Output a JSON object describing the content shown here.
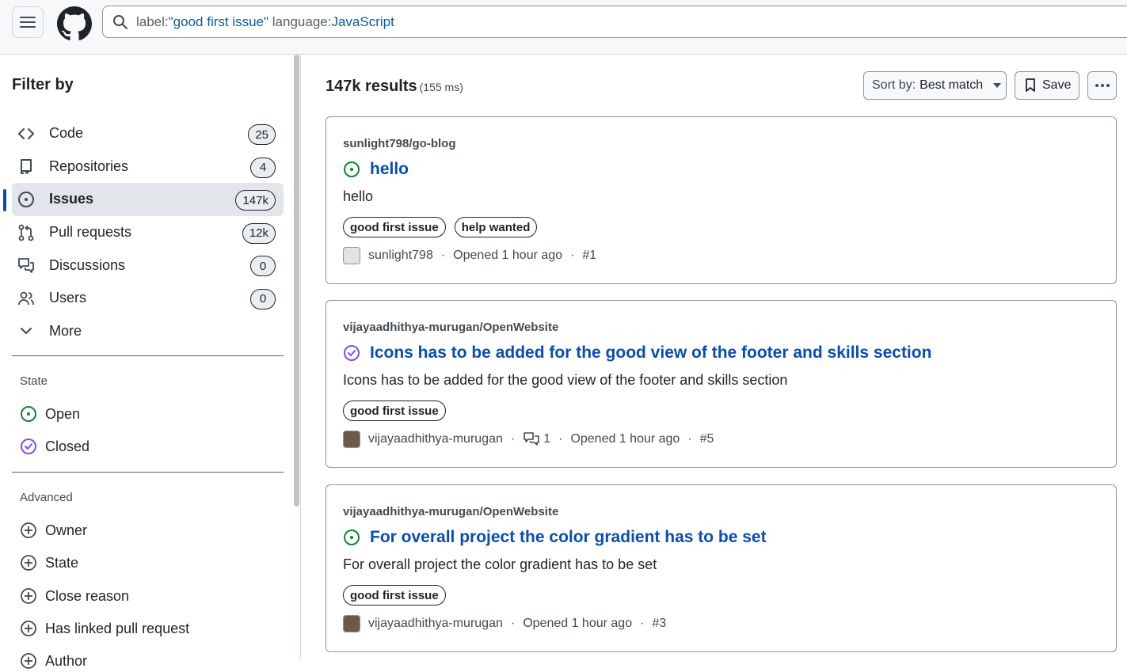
{
  "search": {
    "query_key1": "label:",
    "query_val1": "\"good first issue\"",
    "query_key2": " language:",
    "query_val2": "JavaScript"
  },
  "sidebar": {
    "title": "Filter by",
    "items": [
      {
        "label": "Code",
        "count": "25",
        "icon": "code-icon"
      },
      {
        "label": "Repositories",
        "count": "4",
        "icon": "repo-icon"
      },
      {
        "label": "Issues",
        "count": "147k",
        "icon": "issue-opened-icon",
        "active": true
      },
      {
        "label": "Pull requests",
        "count": "12k",
        "icon": "git-pull-request-icon"
      },
      {
        "label": "Discussions",
        "count": "0",
        "icon": "comment-discussion-icon"
      },
      {
        "label": "Users",
        "count": "0",
        "icon": "people-icon"
      },
      {
        "label": "More",
        "icon": "chevron-down-icon"
      }
    ],
    "state_title": "State",
    "state_options": [
      "Open",
      "Closed"
    ],
    "advanced_title": "Advanced",
    "advanced_options": [
      "Owner",
      "State",
      "Close reason",
      "Has linked pull request",
      "Author"
    ]
  },
  "results": {
    "count": "147k results",
    "time": "(155 ms)",
    "sort_key": "Sort by:",
    "sort_value": "Best match",
    "save_label": "Save"
  },
  "issues": [
    {
      "repo": "sunlight798/go-blog",
      "title": "hello",
      "state": "open",
      "body": "hello",
      "labels": [
        "good first issue",
        "help wanted"
      ],
      "author": "sunlight798",
      "opened": "Opened 1 hour ago",
      "number": "#1"
    },
    {
      "repo": "vijayaadhithya-murugan/OpenWebsite",
      "title": "Icons has to be added for the good view of the footer and skills section",
      "state": "closed",
      "body": "Icons has to be added for the good view of the footer and skills section",
      "labels": [
        "good first issue"
      ],
      "author": "vijayaadhithya-murugan",
      "comments": "1",
      "opened": "Opened 1 hour ago",
      "number": "#5"
    },
    {
      "repo": "vijayaadhithya-murugan/OpenWebsite",
      "title": "For overall project the color gradient has to be set",
      "state": "open",
      "body": "For overall project the color gradient has to be set",
      "labels": [
        "good first issue"
      ],
      "author": "vijayaadhithya-murugan",
      "opened": "Opened 1 hour ago",
      "number": "#3"
    }
  ],
  "colors": {
    "open": "#1a7f37",
    "closed": "#8250df",
    "link": "#0a4dad"
  }
}
